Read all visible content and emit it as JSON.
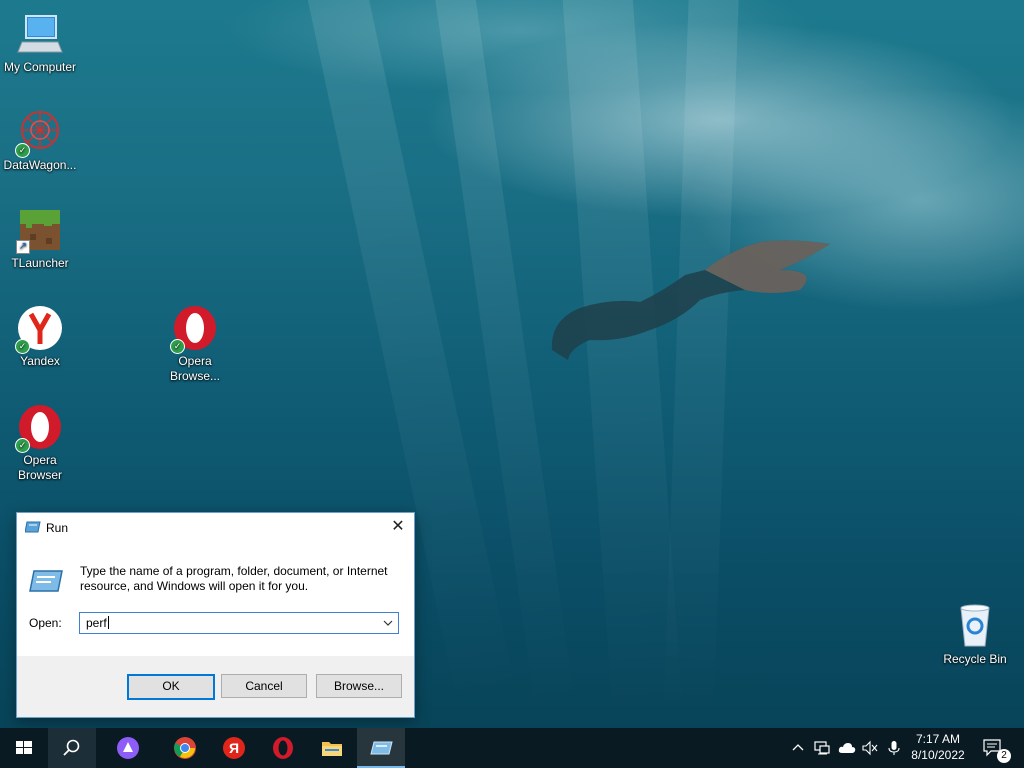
{
  "desktop": {
    "icons": [
      {
        "label": "My Computer"
      },
      {
        "label": "DataWagon..."
      },
      {
        "label": "TLauncher"
      },
      {
        "label": "Yandex"
      },
      {
        "label": "Opera Browser"
      },
      {
        "label": "Opera Browse..."
      },
      {
        "label": "Recycle Bin"
      }
    ]
  },
  "run_dialog": {
    "title": "Run",
    "description": "Type the name of a program, folder, document, or Internet resource, and Windows will open it for you.",
    "open_label": "Open:",
    "open_value": "perf",
    "buttons": {
      "ok": "OK",
      "cancel": "Cancel",
      "browse": "Browse..."
    }
  },
  "taskbar": {
    "apps": [
      "start-icon",
      "search-icon",
      "alice-assistant-icon",
      "chrome-icon",
      "yandex-browser-icon",
      "opera-icon",
      "file-explorer-icon",
      "run-app-icon"
    ],
    "tray": [
      "show-hidden-icons-chevron",
      "network-icon",
      "onedrive-icon",
      "volume-muted-icon",
      "microphone-icon"
    ],
    "time": "7:17 AM",
    "date": "8/10/2022",
    "notification_count": "2"
  },
  "colors": {
    "accent": "#0078d7",
    "taskbar": "#0a1a22",
    "desktop": "#0f5c74"
  }
}
